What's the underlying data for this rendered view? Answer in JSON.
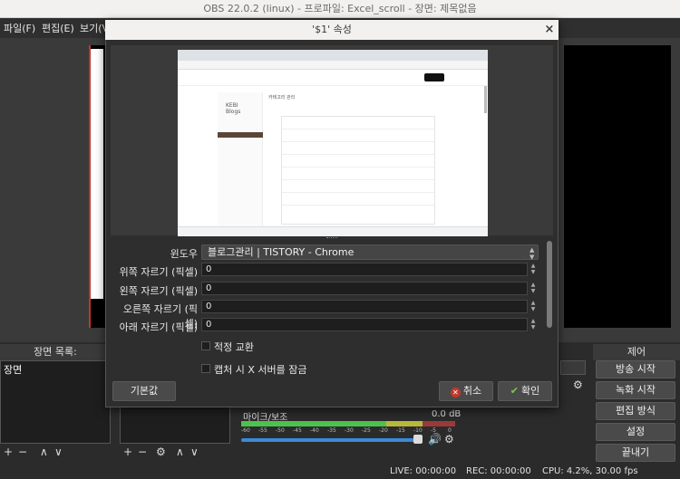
{
  "main_window": {
    "title": "OBS 22.0.2 (linux) - 프로파일: Excel_scroll - 장면: 제목없음",
    "menu": [
      "파일(F)",
      "편집(E)",
      "보기(V"
    ]
  },
  "scenes": {
    "header": "장면 목록:",
    "items": [
      "장면"
    ]
  },
  "mixer": {
    "source_name": "마이크/보조",
    "db": "0.0 dB",
    "ticks": [
      "-60",
      "-55",
      "-50",
      "-45",
      "-40",
      "-35",
      "-30",
      "-25",
      "-20",
      "-15",
      "-10",
      "-5",
      "0"
    ]
  },
  "controls": {
    "header": "제어",
    "buttons": [
      "방송 시작",
      "녹화 시작",
      "편집 방식",
      "설정",
      "끝내기"
    ]
  },
  "status": {
    "live": "LIVE: 00:00:00",
    "rec": "REC: 00:00:00",
    "cpu": "CPU: 4.2%, 30.00 fps"
  },
  "dialog": {
    "title": "'$1' 속성",
    "close": "×",
    "preview": {
      "logo": "KEBI\nBlogs",
      "heading": "카테고리 관리"
    },
    "fields": {
      "window_label": "윈도우",
      "window_value": "블로그관리 | TISTORY - Chrome",
      "crop_top_label": "위쪽 자르기 (픽셀)",
      "crop_top_value": "0",
      "crop_left_label": "왼쪽 자르기 (픽셀)",
      "crop_left_value": "0",
      "crop_right_label": "오른쪽 자르기 (픽셀)",
      "crop_right_value": "0",
      "crop_bottom_label": "아래 자르기 (픽셀)",
      "crop_bottom_value": "0",
      "swap_label": "적정 교환",
      "lock_label": "캡처 시 X 서버를 잠금"
    },
    "buttons": {
      "defaults": "기본값",
      "cancel": "취소",
      "ok": "확인"
    }
  }
}
